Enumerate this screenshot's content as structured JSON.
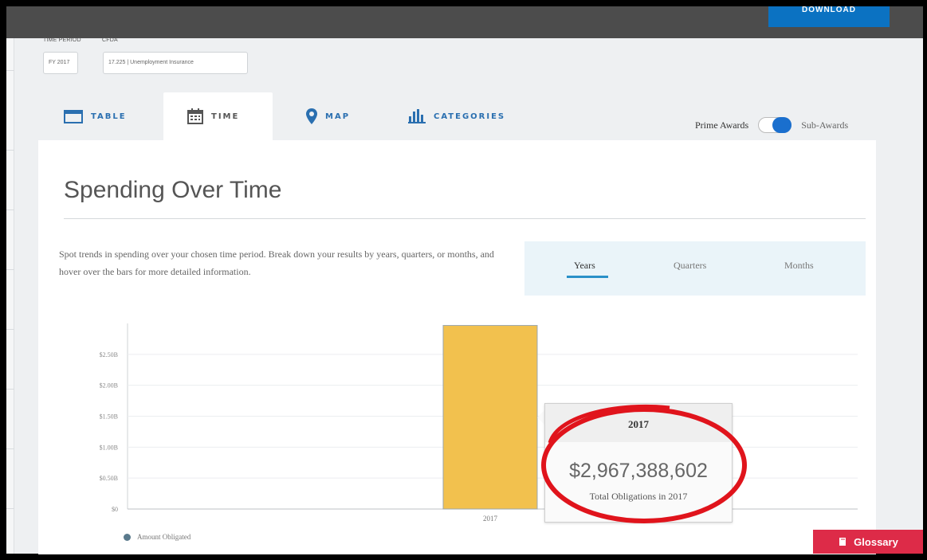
{
  "header": {
    "download_label": "DOWNLOAD"
  },
  "filters": {
    "time_period_label": "TIME PERIOD",
    "cfda_label": "CFDA",
    "time_period_value": "FY 2017",
    "cfda_value": "17.225 | Unemployment Insurance"
  },
  "tabs": [
    {
      "label": "TABLE",
      "icon": "table-icon",
      "active": false
    },
    {
      "label": "TIME",
      "icon": "calendar-icon",
      "active": true
    },
    {
      "label": "MAP",
      "icon": "map-pin-icon",
      "active": false
    },
    {
      "label": "CATEGORIES",
      "icon": "bar-chart-icon",
      "active": false
    }
  ],
  "awards_toggle": {
    "left_label": "Prime Awards",
    "right_label": "Sub-Awards",
    "selected": "Sub-Awards"
  },
  "panel": {
    "title": "Spending Over Time",
    "description": "Spot trends in spending over your chosen time period. Break down your results by years, quarters, or months, and hover over the bars for more detailed information."
  },
  "period_options": [
    {
      "label": "Years",
      "active": true
    },
    {
      "label": "Quarters",
      "active": false
    },
    {
      "label": "Months",
      "active": false
    }
  ],
  "chart_data": {
    "type": "bar",
    "categories": [
      "2017"
    ],
    "series": [
      {
        "name": "Amount Obligated",
        "values": [
          2967388602
        ]
      }
    ],
    "y_ticks": [
      "$0",
      "$0.50B",
      "$1.00B",
      "$1.50B",
      "$2.00B",
      "$2.50B"
    ],
    "ylim": [
      0,
      3000000000
    ],
    "grid": true,
    "bar_color": "#f2c14e",
    "legend_position": "bottom-left"
  },
  "tooltip": {
    "year": "2017",
    "value": "$2,967,388,602",
    "label": "Total Obligations in 2017"
  },
  "annotation": {
    "color": "#e0141c"
  },
  "glossary": {
    "label": "Glossary"
  },
  "colors": {
    "accent": "#0b72c2",
    "glossary": "#dd2b48",
    "topbar": "#4c4c4c"
  }
}
